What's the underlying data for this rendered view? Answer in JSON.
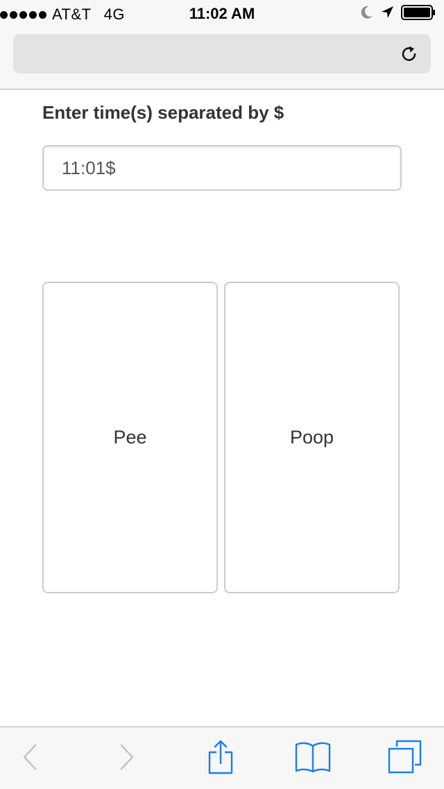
{
  "status_bar": {
    "carrier": "AT&T",
    "network": "4G",
    "time": "11:02 AM",
    "signal_bars": 5,
    "icons": [
      "moon-icon",
      "location-arrow-icon",
      "battery-icon"
    ]
  },
  "address_bar": {
    "url": "",
    "reload_icon": "reload-icon"
  },
  "form": {
    "label": "Enter time(s) separated by $",
    "time_input_value": "11:01$"
  },
  "buttons": {
    "pee_label": "Pee",
    "poop_label": "Poop"
  },
  "toolbar": {
    "icons": [
      "back-icon",
      "forward-icon",
      "share-icon",
      "bookmarks-icon",
      "tabs-icon"
    ]
  },
  "colors": {
    "accent": "#1a7cf0",
    "disabled": "#c4c4c8",
    "bar_background": "#f7f7f7",
    "border": "#cccccc"
  }
}
